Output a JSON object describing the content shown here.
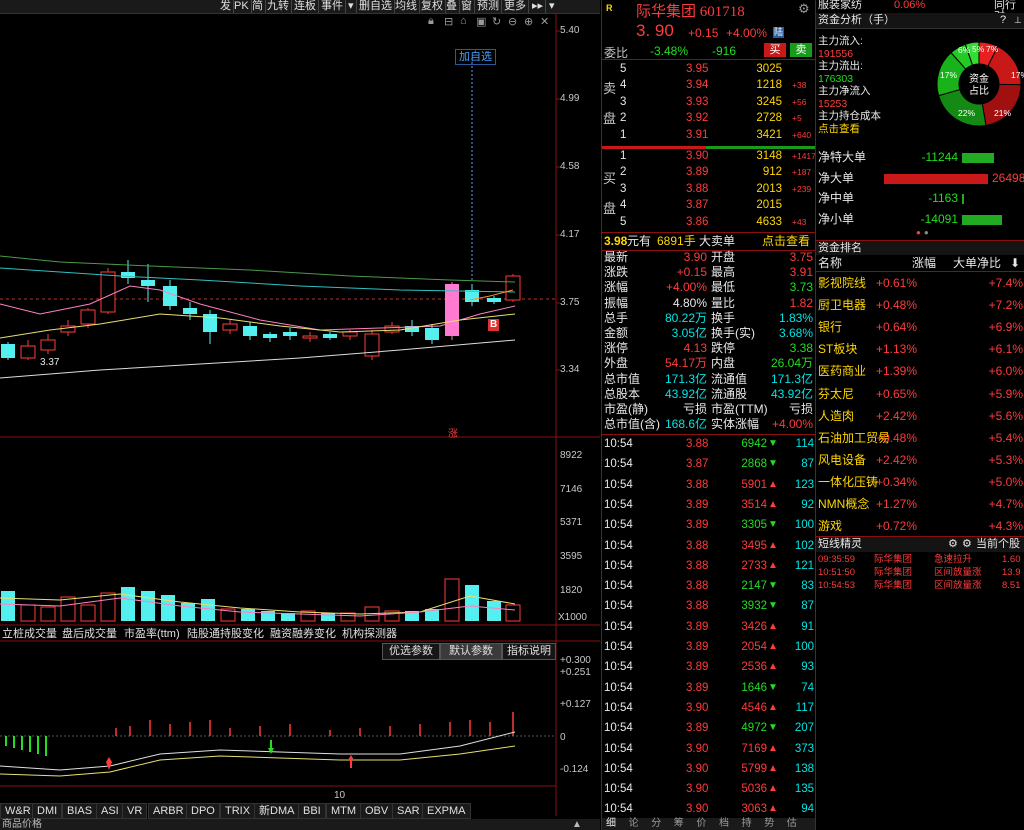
{
  "toolbar": {
    "items": [
      "发",
      "PK",
      "简",
      "九转",
      "连板",
      "事件",
      "▾",
      "删自选",
      "均线",
      "复权",
      "叠",
      "窗",
      "预测",
      "更多"
    ],
    "add_watch_label": "加自选"
  },
  "chart": {
    "price_axis": [
      "5.40",
      "4.99",
      "4.58",
      "4.17",
      "3.75",
      "3.34"
    ],
    "low_marker": "3.37",
    "rise_tag": "涨",
    "b_tag": "B",
    "volume_axis": [
      "8922",
      "7146",
      "5371",
      "3595",
      "1820",
      "X1000"
    ],
    "indicator_tabs": [
      "立桩成交量",
      "盘后成交量",
      "市盈率(ttm)",
      "陆股通持股变化",
      "融资融券变化",
      "机构探测器"
    ],
    "param_buttons": [
      "优选参数",
      "默认参数",
      "指标说明"
    ],
    "macd_axis": [
      "+0.300",
      "+0.251",
      "+0.127",
      "0",
      "-0.124"
    ],
    "macd_xlabel": "10",
    "bottom_tabs": [
      "W&R",
      "DMI",
      "BIAS",
      "ASI",
      "VR",
      "ARBR",
      "DPO",
      "TRIX",
      "新DMA",
      "BBI",
      "MTM",
      "OBV",
      "SAR",
      "EXPMA"
    ],
    "bottom_strip": "商品价格"
  },
  "quote": {
    "badge": "R",
    "name": "际华集团 601718",
    "price": "3. 90",
    "change": "+0.15",
    "change_pct": "+4.00%",
    "tag": "陆",
    "weibi_label": "委比",
    "weibi_val": "-3.48%",
    "weicha_val": "-916",
    "buy_btn": "买",
    "sell_btn": "卖",
    "sell_side_label": [
      "卖",
      "盘"
    ],
    "buy_side_label": [
      "买",
      "盘"
    ],
    "asks": [
      {
        "lvl": "5",
        "price": "3.95",
        "vol": "3025",
        "chg": ""
      },
      {
        "lvl": "4",
        "price": "3.94",
        "vol": "1218",
        "chg": "+38"
      },
      {
        "lvl": "3",
        "price": "3.93",
        "vol": "3245",
        "chg": "+56"
      },
      {
        "lvl": "2",
        "price": "3.92",
        "vol": "2728",
        "chg": "+5"
      },
      {
        "lvl": "1",
        "price": "3.91",
        "vol": "3421",
        "chg": "+640"
      }
    ],
    "bids": [
      {
        "lvl": "1",
        "price": "3.90",
        "vol": "3148",
        "chg": "+1417"
      },
      {
        "lvl": "2",
        "price": "3.89",
        "vol": "912",
        "chg": "+187"
      },
      {
        "lvl": "3",
        "price": "3.88",
        "vol": "2013",
        "chg": "+239"
      },
      {
        "lvl": "4",
        "price": "3.87",
        "vol": "2015",
        "chg": ""
      },
      {
        "lvl": "5",
        "price": "3.86",
        "vol": "4633",
        "chg": "+43"
      }
    ],
    "big_order": {
      "price": "3.98",
      "unit": "元有",
      "vol": "6891手",
      "label": "大卖单",
      "link": "点击查看"
    },
    "stats": [
      [
        "最新",
        "3.90",
        "开盘",
        "3.75"
      ],
      [
        "涨跌",
        "+0.15",
        "最高",
        "3.91"
      ],
      [
        "涨幅",
        "+4.00%",
        "最低",
        "3.73"
      ],
      [
        "振幅",
        "4.80%",
        "量比",
        "1.82"
      ],
      [
        "总手",
        "80.22万",
        "换手",
        "1.83%"
      ],
      [
        "金额",
        "3.05亿",
        "换手(实)",
        "3.68%"
      ],
      [
        "涨停",
        "4.13",
        "跌停",
        "3.38"
      ],
      [
        "外盘",
        "54.17万",
        "内盘",
        "26.04万"
      ],
      [
        "总市值",
        "171.3亿",
        "流通值",
        "171.3亿"
      ],
      [
        "总股本",
        "43.92亿",
        "流通股",
        "43.92亿"
      ],
      [
        "市盈(静)",
        "亏损",
        "市盈(TTM)",
        "亏损"
      ],
      [
        "总市值(含)",
        "168.6亿",
        "实体涨幅",
        "+4.00%"
      ]
    ],
    "ticks": [
      {
        "t": "10:54",
        "p": "3.88",
        "v": "6942",
        "d": "down",
        "n": "114"
      },
      {
        "t": "10:54",
        "p": "3.87",
        "v": "2868",
        "d": "down",
        "n": "87"
      },
      {
        "t": "10:54",
        "p": "3.88",
        "v": "5901",
        "d": "up",
        "n": "123"
      },
      {
        "t": "10:54",
        "p": "3.89",
        "v": "3514",
        "d": "up",
        "n": "92"
      },
      {
        "t": "10:54",
        "p": "3.89",
        "v": "3305",
        "d": "down",
        "n": "100"
      },
      {
        "t": "10:54",
        "p": "3.88",
        "v": "3495",
        "d": "up",
        "n": "102"
      },
      {
        "t": "10:54",
        "p": "3.88",
        "v": "2733",
        "d": "up",
        "n": "121"
      },
      {
        "t": "10:54",
        "p": "3.88",
        "v": "2147",
        "d": "down",
        "n": "83"
      },
      {
        "t": "10:54",
        "p": "3.88",
        "v": "3932",
        "d": "down",
        "n": "87"
      },
      {
        "t": "10:54",
        "p": "3.89",
        "v": "3426",
        "d": "up",
        "n": "91"
      },
      {
        "t": "10:54",
        "p": "3.89",
        "v": "2054",
        "d": "up",
        "n": "100"
      },
      {
        "t": "10:54",
        "p": "3.89",
        "v": "2536",
        "d": "up",
        "n": "93"
      },
      {
        "t": "10:54",
        "p": "3.89",
        "v": "1646",
        "d": "down",
        "n": "74"
      },
      {
        "t": "10:54",
        "p": "3.90",
        "v": "4546",
        "d": "up",
        "n": "117"
      },
      {
        "t": "10:54",
        "p": "3.89",
        "v": "4972",
        "d": "down",
        "n": "207"
      },
      {
        "t": "10:54",
        "p": "3.90",
        "v": "7169",
        "d": "up",
        "n": "373"
      },
      {
        "t": "10:54",
        "p": "3.90",
        "v": "5799",
        "d": "up",
        "n": "138"
      },
      {
        "t": "10:54",
        "p": "3.90",
        "v": "5036",
        "d": "up",
        "n": "135"
      },
      {
        "t": "10:54",
        "p": "3.90",
        "v": "3063",
        "d": "up",
        "n": "94"
      }
    ],
    "bottom_tabs": [
      "细",
      "论",
      "分",
      "筹",
      "价",
      "档",
      "持",
      "势",
      "估"
    ]
  },
  "right": {
    "top_sector": "服装家纺",
    "top_sector_pct": "0.06%",
    "top_right": "同行对",
    "fund_title": "资金分析（手）",
    "help": "?",
    "inflow_label": "主力流入:",
    "inflow_val": "191556",
    "outflow_label": "主力流出:",
    "outflow_val": "176303",
    "net_label": "主力净流入",
    "net_val": "15253",
    "cost_label": "主力持仓成本",
    "cost_link": "点击查看",
    "pie_center": [
      "资金",
      "占比"
    ],
    "pie_labels": [
      "6%",
      "5%",
      "7%",
      "17%",
      "21%",
      "22%",
      "17%"
    ],
    "flows": [
      {
        "label": "净特大单",
        "val": "-11244",
        "color": "green"
      },
      {
        "label": "净大单",
        "val": "26498",
        "color": "red"
      },
      {
        "label": "净中单",
        "val": "-1163",
        "color": "green"
      },
      {
        "label": "净小单",
        "val": "-14091",
        "color": "green"
      }
    ],
    "sector_title": "资金排名",
    "sector_headers": [
      "名称",
      "涨幅",
      "大单净比"
    ],
    "sectors": [
      [
        "影视院线",
        "+0.61%",
        "+7.4%"
      ],
      [
        "厨卫电器",
        "+0.48%",
        "+7.2%"
      ],
      [
        "银行",
        "+0.64%",
        "+6.9%"
      ],
      [
        "ST板块",
        "+1.13%",
        "+6.1%"
      ],
      [
        "医药商业",
        "+1.39%",
        "+6.0%"
      ],
      [
        "芬太尼",
        "+0.65%",
        "+5.9%"
      ],
      [
        "人造肉",
        "+2.42%",
        "+5.6%"
      ],
      [
        "石油加工贸易",
        "+0.48%",
        "+5.4%"
      ],
      [
        "风电设备",
        "+2.42%",
        "+5.3%"
      ],
      [
        "一体化压铸",
        "+0.34%",
        "+5.0%"
      ],
      [
        "NMN概念",
        "+1.27%",
        "+4.7%"
      ],
      [
        "游戏",
        "+0.72%",
        "+4.3%"
      ]
    ],
    "sprite_title": "短线精灵",
    "sprite_filter": "当前个股",
    "sprites": [
      [
        "09:35:59",
        "际华集团",
        "急速拉升",
        "1.60"
      ],
      [
        "10:51:50",
        "际华集团",
        "区间放量涨",
        "13.9"
      ],
      [
        "10:54:53",
        "际华集团",
        "区间放量涨",
        "8.51"
      ]
    ]
  }
}
